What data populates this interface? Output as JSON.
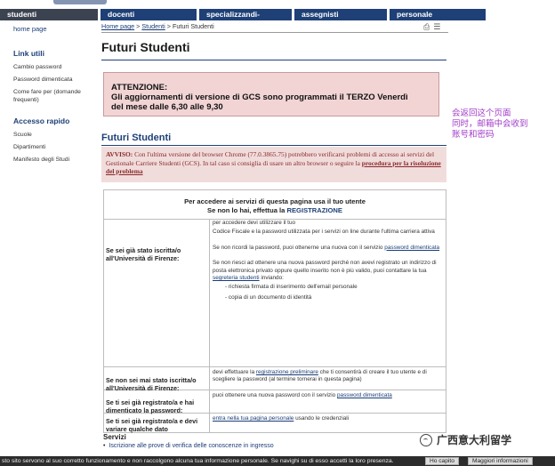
{
  "nav": {
    "tabs": [
      {
        "label": "studenti",
        "active": true
      },
      {
        "label": "docenti",
        "active": false
      },
      {
        "label": "specializzandi-dottorandi",
        "active": false
      },
      {
        "label": "assegnisti",
        "active": false
      },
      {
        "label": "personale",
        "active": false
      }
    ]
  },
  "sidebar": {
    "home": "home page",
    "link_utili_title": "Link utili",
    "link_utili": [
      "Cambio password",
      "Password dimenticata",
      "Come fare per (domande frequenti)"
    ],
    "accesso_title": "Accesso rapido",
    "accesso": [
      "Scuole",
      "Dipartimenti",
      "Manifesto degli Studi"
    ]
  },
  "breadcrumb": {
    "home": "Home page",
    "studenti": "Studenti",
    "current": "Futuri Studenti",
    "sep": ">"
  },
  "page": {
    "title": "Futuri Studenti",
    "subtitle": "Futuri Studenti"
  },
  "alert": {
    "heading": "ATTENZIONE:",
    "line1": "Gli aggiornamenti di versione di GCS sono programmati il TERZO Venerdì",
    "line2": "del mese dalle 6,30 alle 9,30"
  },
  "avviso": {
    "lead": "AVVISO:",
    "text": " Con l'ultima versione del browser Chrome (77.0.3865.75) potrebbero verificarsi problemi di accesso ai servizi del Gestionale Carriere Studenti (GCS). In tal caso si consiglia di usare un altro browser o seguire la ",
    "link": "procedura per la risoluzione del problema"
  },
  "panel": {
    "head1": "Per accedere ai servizi di questa pagina usa il tuo utente",
    "head2_pre": "Se non lo hai, effettua la ",
    "head2_link": "REGISTRAZIONE",
    "rows": [
      {
        "label": "Se sei già stato iscritta/o all'Università di Firenze:",
        "p1": "per accedere devi utilizzare il tuo",
        "p2": "Codice Fiscale e la password utilizzata per i servizi on line durante l'ultima carriera attiva",
        "p3_pre": "Se non ricordi la password,  puoi ottenerne una nuova con il servizio ",
        "p3_link": "password dimenticata",
        "p4_pre": "Se non riesci ad ottenere una nuova password perché non avevi registrato un indirizzo di posta elettronica privato oppure quello inserito non è più valido, puoi contattare la tua ",
        "p4_link": "segreteria studenti",
        "p4_post": " inviando:",
        "b1": "- richiesta firmata di inserimento dell'email personale",
        "b2": "- copia di un documento di identità"
      },
      {
        "label": "Se non sei mai stato iscritta/o all'Università di Firenze:",
        "pre": "devi effettuare la ",
        "link": "registrazione preliminare",
        "post": " che ti consentirà di creare il tuo utente e di scegliere la password (al termine tornerai in questa pagina)"
      },
      {
        "label": "Se ti sei già registrato/a e hai dimenticato la password:",
        "pre": "puoi ottenere una nuova password con il servizio ",
        "link": "password dimenticata",
        "post": ""
      },
      {
        "label": "Se ti sei già registrato/a e devi variare qualche dato",
        "pre": "",
        "link": "entra nella tua pagina personale",
        "post": " usando le credenziali"
      }
    ]
  },
  "servizi": {
    "title": "Servizi",
    "item": "Iscrizione alle prove di verifica delle conoscenze in ingresso"
  },
  "annotation": [
    "会返回这个页面",
    "同时，邮箱中会收到",
    "账号和密码"
  ],
  "watermark": "广西意大利留学",
  "cookie": {
    "text": "sto sito servono al suo corretto funzionamento e non raccolgono alcuna tua informazione personale. Se navighi su di esso accetti la loro presenza.",
    "ok": "Ho capito",
    "more": "Maggiori informazioni"
  }
}
